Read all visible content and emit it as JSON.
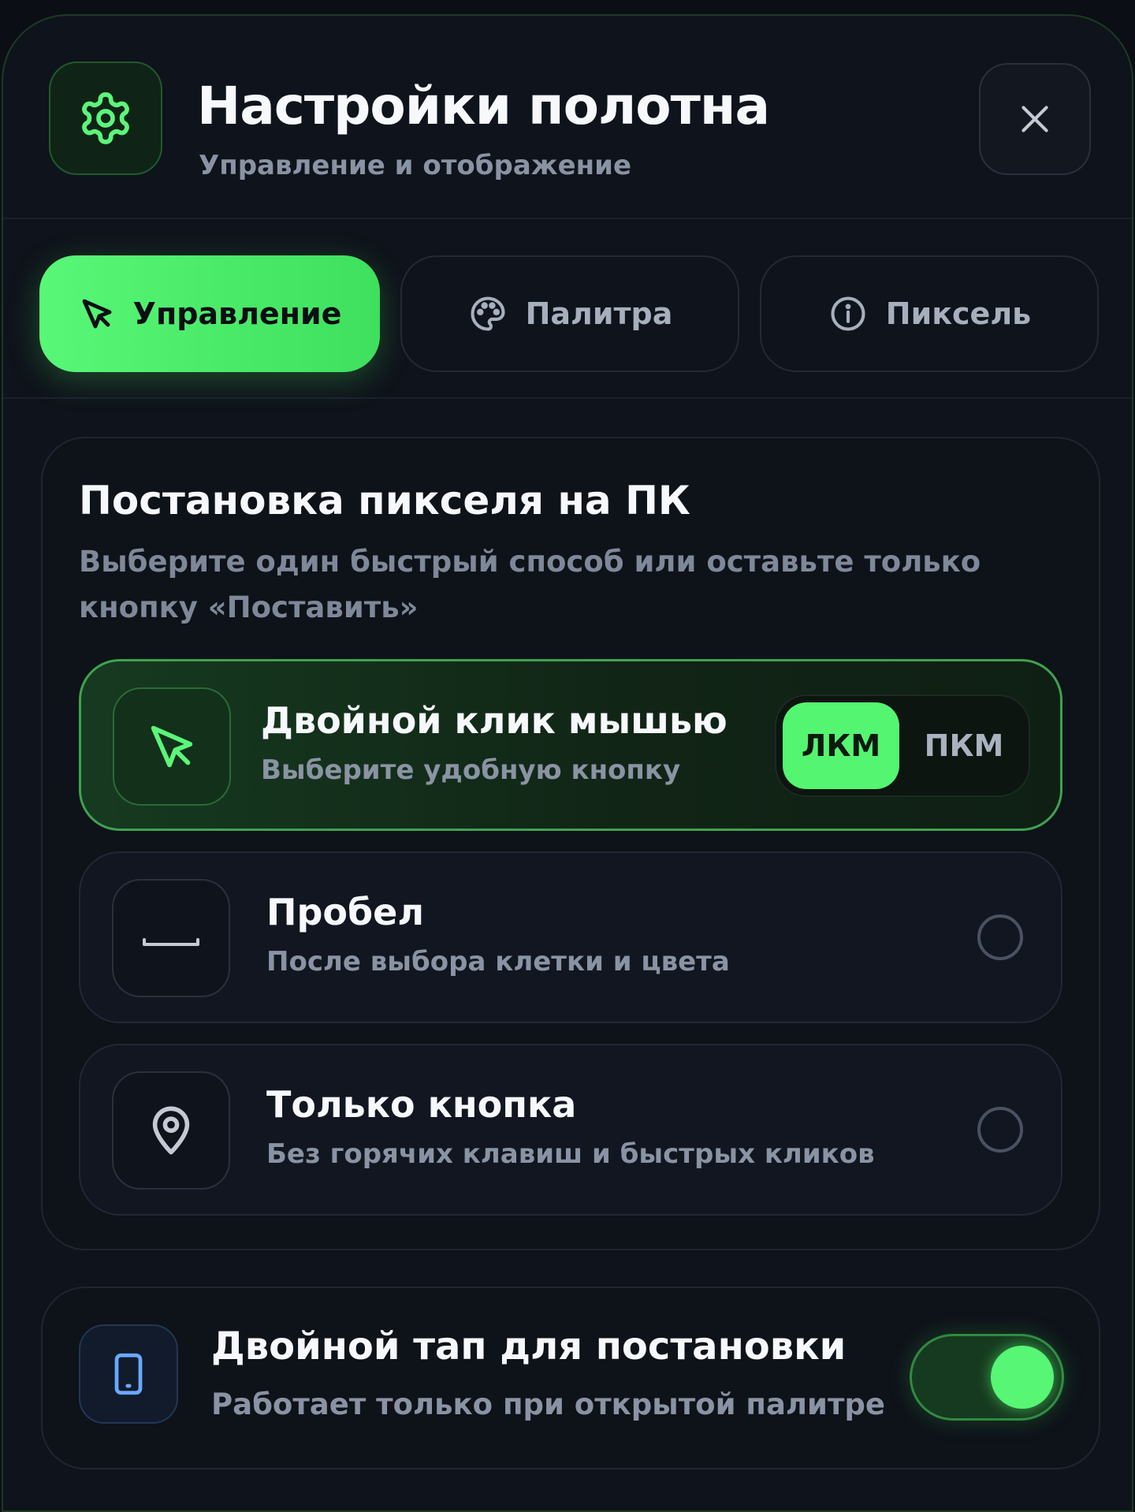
{
  "header": {
    "title": "Настройки полотна",
    "subtitle": "Управление и отображение",
    "icon": "gear-icon",
    "close_icon": "close-icon"
  },
  "tabs": [
    {
      "label": "Управление",
      "icon": "cursor-icon",
      "active": true
    },
    {
      "label": "Палитра",
      "icon": "palette-icon",
      "active": false
    },
    {
      "label": "Пиксель",
      "icon": "info-icon",
      "active": false
    }
  ],
  "placement": {
    "title": "Постановка пикселя на ПК",
    "description": "Выберите один быстрый способ или оставьте только кнопку «Поставить»",
    "options": [
      {
        "title": "Двойной клик мышью",
        "subtitle": "Выберите удобную кнопку",
        "icon": "cursor-icon",
        "selected": true,
        "buttons": [
          {
            "label": "ЛКМ",
            "active": true
          },
          {
            "label": "ПКМ",
            "active": false
          }
        ]
      },
      {
        "title": "Пробел",
        "subtitle": "После выбора клетки и цвета",
        "icon": "spacebar-icon",
        "selected": false
      },
      {
        "title": "Только кнопка",
        "subtitle": "Без горячих клавиш и быстрых кликов",
        "icon": "map-pin-icon",
        "selected": false
      }
    ]
  },
  "double_tap": {
    "title": "Двойной тап для постановки",
    "subtitle": "Работает только при открытой палитре",
    "icon": "smartphone-icon",
    "enabled": true
  },
  "colors": {
    "accent": "#54f571",
    "background": "#0f131b",
    "muted_text": "#8a93a3"
  }
}
